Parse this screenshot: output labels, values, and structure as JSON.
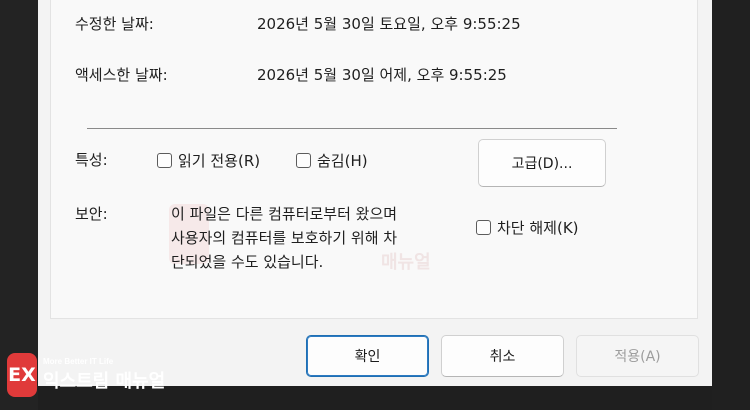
{
  "details": {
    "modified_label": "수정한 날짜:",
    "modified_value": "2026년 5월 30일 토요일, 오후 9:55:25",
    "accessed_label": "액세스한 날짜:",
    "accessed_value": "2026년 5월 30일 어제, 오후 9:55:25"
  },
  "attributes": {
    "label": "특성:",
    "readonly_label": "읽기 전용(R)",
    "readonly_checked": false,
    "hidden_label": "숨김(H)",
    "hidden_checked": false,
    "advanced_button": "고급(D)..."
  },
  "security": {
    "label": "보안:",
    "message_lines": [
      "이 파일은 다른 컴퓨터로부터 왔으며",
      "사용자의 컴퓨터를 보호하기 위해 차",
      "단되었을 수도 있습니다."
    ],
    "unblock_label": "차단 해제(K)",
    "unblock_checked": false
  },
  "footer": {
    "ok_button": "확인",
    "cancel_button": "취소",
    "apply_button": "적용(A)"
  },
  "watermark": {
    "logo_letter": "EX",
    "tagline": "More Better IT Life",
    "name": "익스트림 매뉴얼"
  },
  "colors": {
    "dialog_bg": "#f3f3f3",
    "panel_bg": "#f9f9f9",
    "primary_border": "#1f6fb3",
    "logo_red": "#e03a3a"
  }
}
